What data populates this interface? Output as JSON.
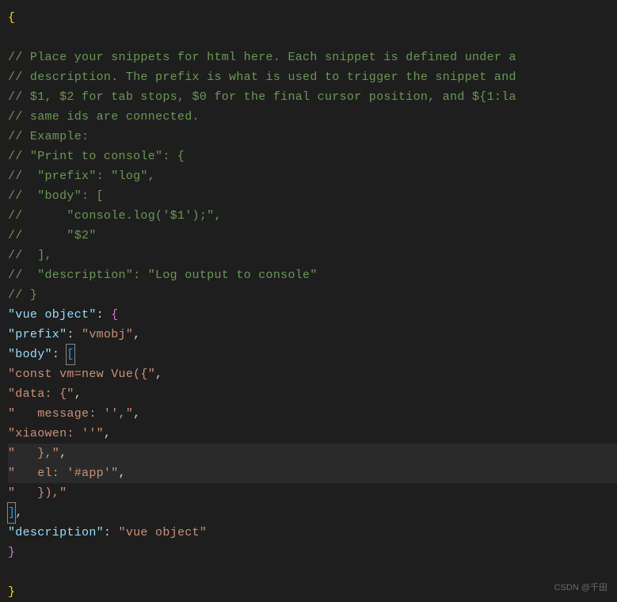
{
  "code": {
    "open_brace": "{",
    "comments": [
      "// Place your snippets for html here. Each snippet is defined under a",
      "// description. The prefix is what is used to trigger the snippet and",
      "// $1, $2 for tab stops, $0 for the final cursor position, and ${1:la",
      "// same ids are connected.",
      "// Example:",
      "// \"Print to console\": {",
      "//  \"prefix\": \"log\",",
      "//  \"body\": [",
      "//      \"console.log('$1');\",",
      "//      \"$2\"",
      "//  ],",
      "//  \"description\": \"Log output to console\"",
      "// }"
    ],
    "snippet_key": "\"vue object\"",
    "prefix_key": "\"prefix\"",
    "prefix_val": "\"vmobj\"",
    "body_key": "\"body\"",
    "body_lines": [
      "\"const vm=new Vue({\"",
      "\"data: {\"",
      "\"   message: '',\"",
      "\"xiaowen: ''\"",
      "\"   },\"",
      "\"   el: '#app'\"",
      "\"   }),\""
    ],
    "desc_key": "\"description\"",
    "desc_val": "\"vue object\"",
    "close_brace": "}"
  },
  "watermark": "CSDN @千田"
}
